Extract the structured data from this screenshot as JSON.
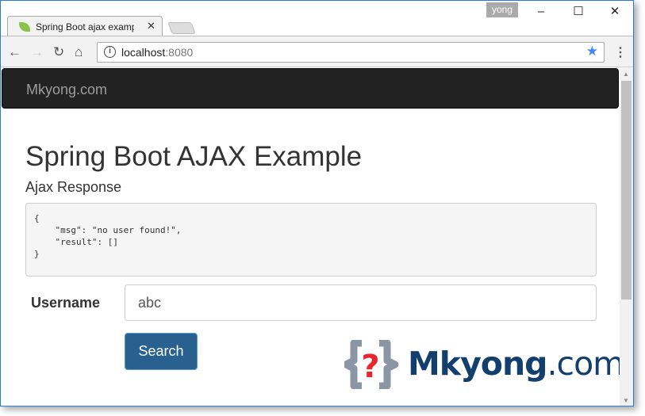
{
  "browser": {
    "user": "yong",
    "tab_title": "Spring Boot ajax example",
    "url_host": "localhost",
    "url_port": ":8080"
  },
  "page": {
    "brand": "Mkyong.com",
    "title": "Spring Boot AJAX Example",
    "response_heading": "Ajax Response",
    "response_json": "{\n    \"msg\": \"no user found!\",\n    \"result\": []\n}",
    "username_label": "Username",
    "username_value": "abc",
    "search_label": "Search",
    "logo": {
      "name": "Mkyong",
      ".com": ".com",
      "symbol": "?"
    }
  }
}
